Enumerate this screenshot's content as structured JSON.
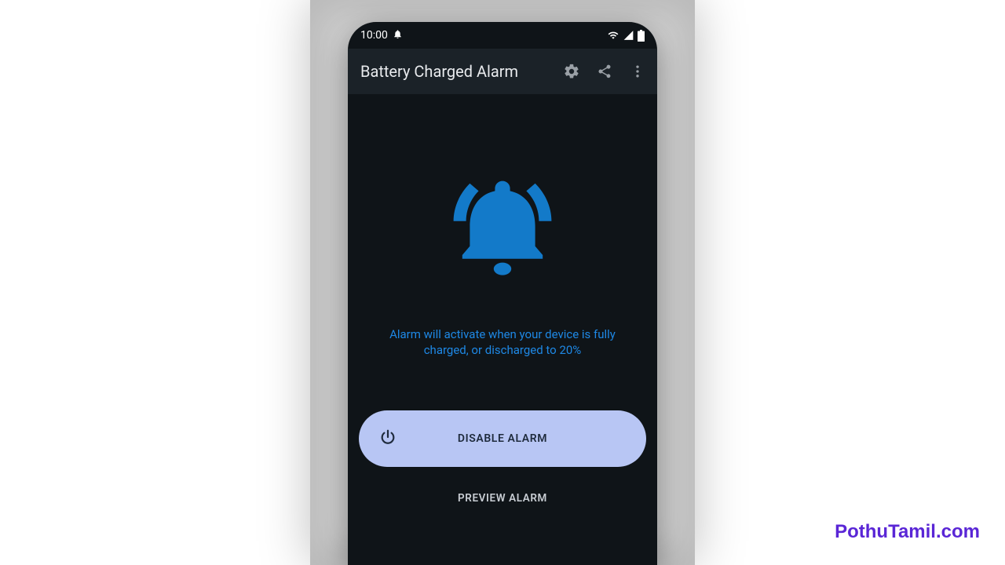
{
  "statusbar": {
    "time": "10:00"
  },
  "appbar": {
    "title": "Battery Charged Alarm"
  },
  "main": {
    "info_text": "Alarm will activate when your device is fully charged, or discharged to 20%",
    "disable_label": "DISABLE ALARM",
    "preview_label": "PREVIEW ALARM"
  },
  "accent_color": "#1e88e5",
  "button_bg": "#b8c6f4",
  "watermark": "PothuTamil.com"
}
